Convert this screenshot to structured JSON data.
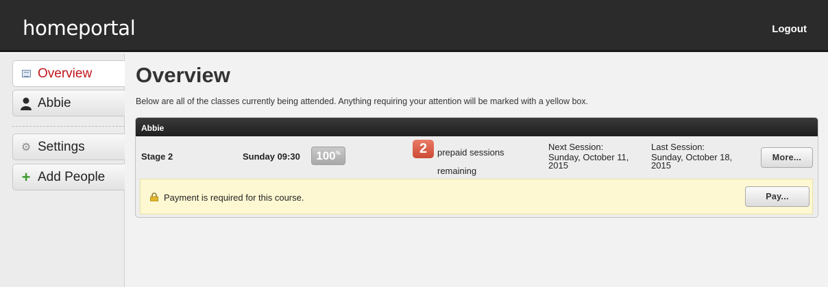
{
  "topbar": {
    "brand": "homeportal",
    "logout_label": "Logout"
  },
  "sidebar": {
    "items": [
      {
        "label": "Overview",
        "icon": "overview-grid-icon",
        "active": true
      },
      {
        "label": "Abbie",
        "icon": "person-icon",
        "active": false
      },
      {
        "label": "Settings",
        "icon": "gear-icon",
        "active": false
      },
      {
        "label": "Add People",
        "icon": "plus-icon",
        "active": false
      }
    ]
  },
  "main": {
    "title": "Overview",
    "intro": "Below are all of the classes currently being attended. Anything requiring your attention will be marked with a yellow box.",
    "cards": [
      {
        "name": "Abbie",
        "class": {
          "stage": "Stage 2",
          "time": "Sunday 09:30",
          "percent": "100",
          "percent_suffix": "%",
          "prepaid_count": "2",
          "prepaid_text": "prepaid sessions remaining",
          "next_label": "Next Session:",
          "next_date": "Sunday, October 11, 2015",
          "last_label": "Last Session:",
          "last_date": "Sunday, October 18, 2015",
          "more_label": "More..."
        },
        "alert": {
          "icon": "lock-icon",
          "message": "Payment is required for this course.",
          "pay_label": "Pay..."
        }
      }
    ]
  },
  "colors": {
    "topbar_bg": "#2b2b2b",
    "active_nav_text": "#c0151b",
    "alert_bg": "#fdf8d2",
    "count_badge": "#d9543e"
  }
}
